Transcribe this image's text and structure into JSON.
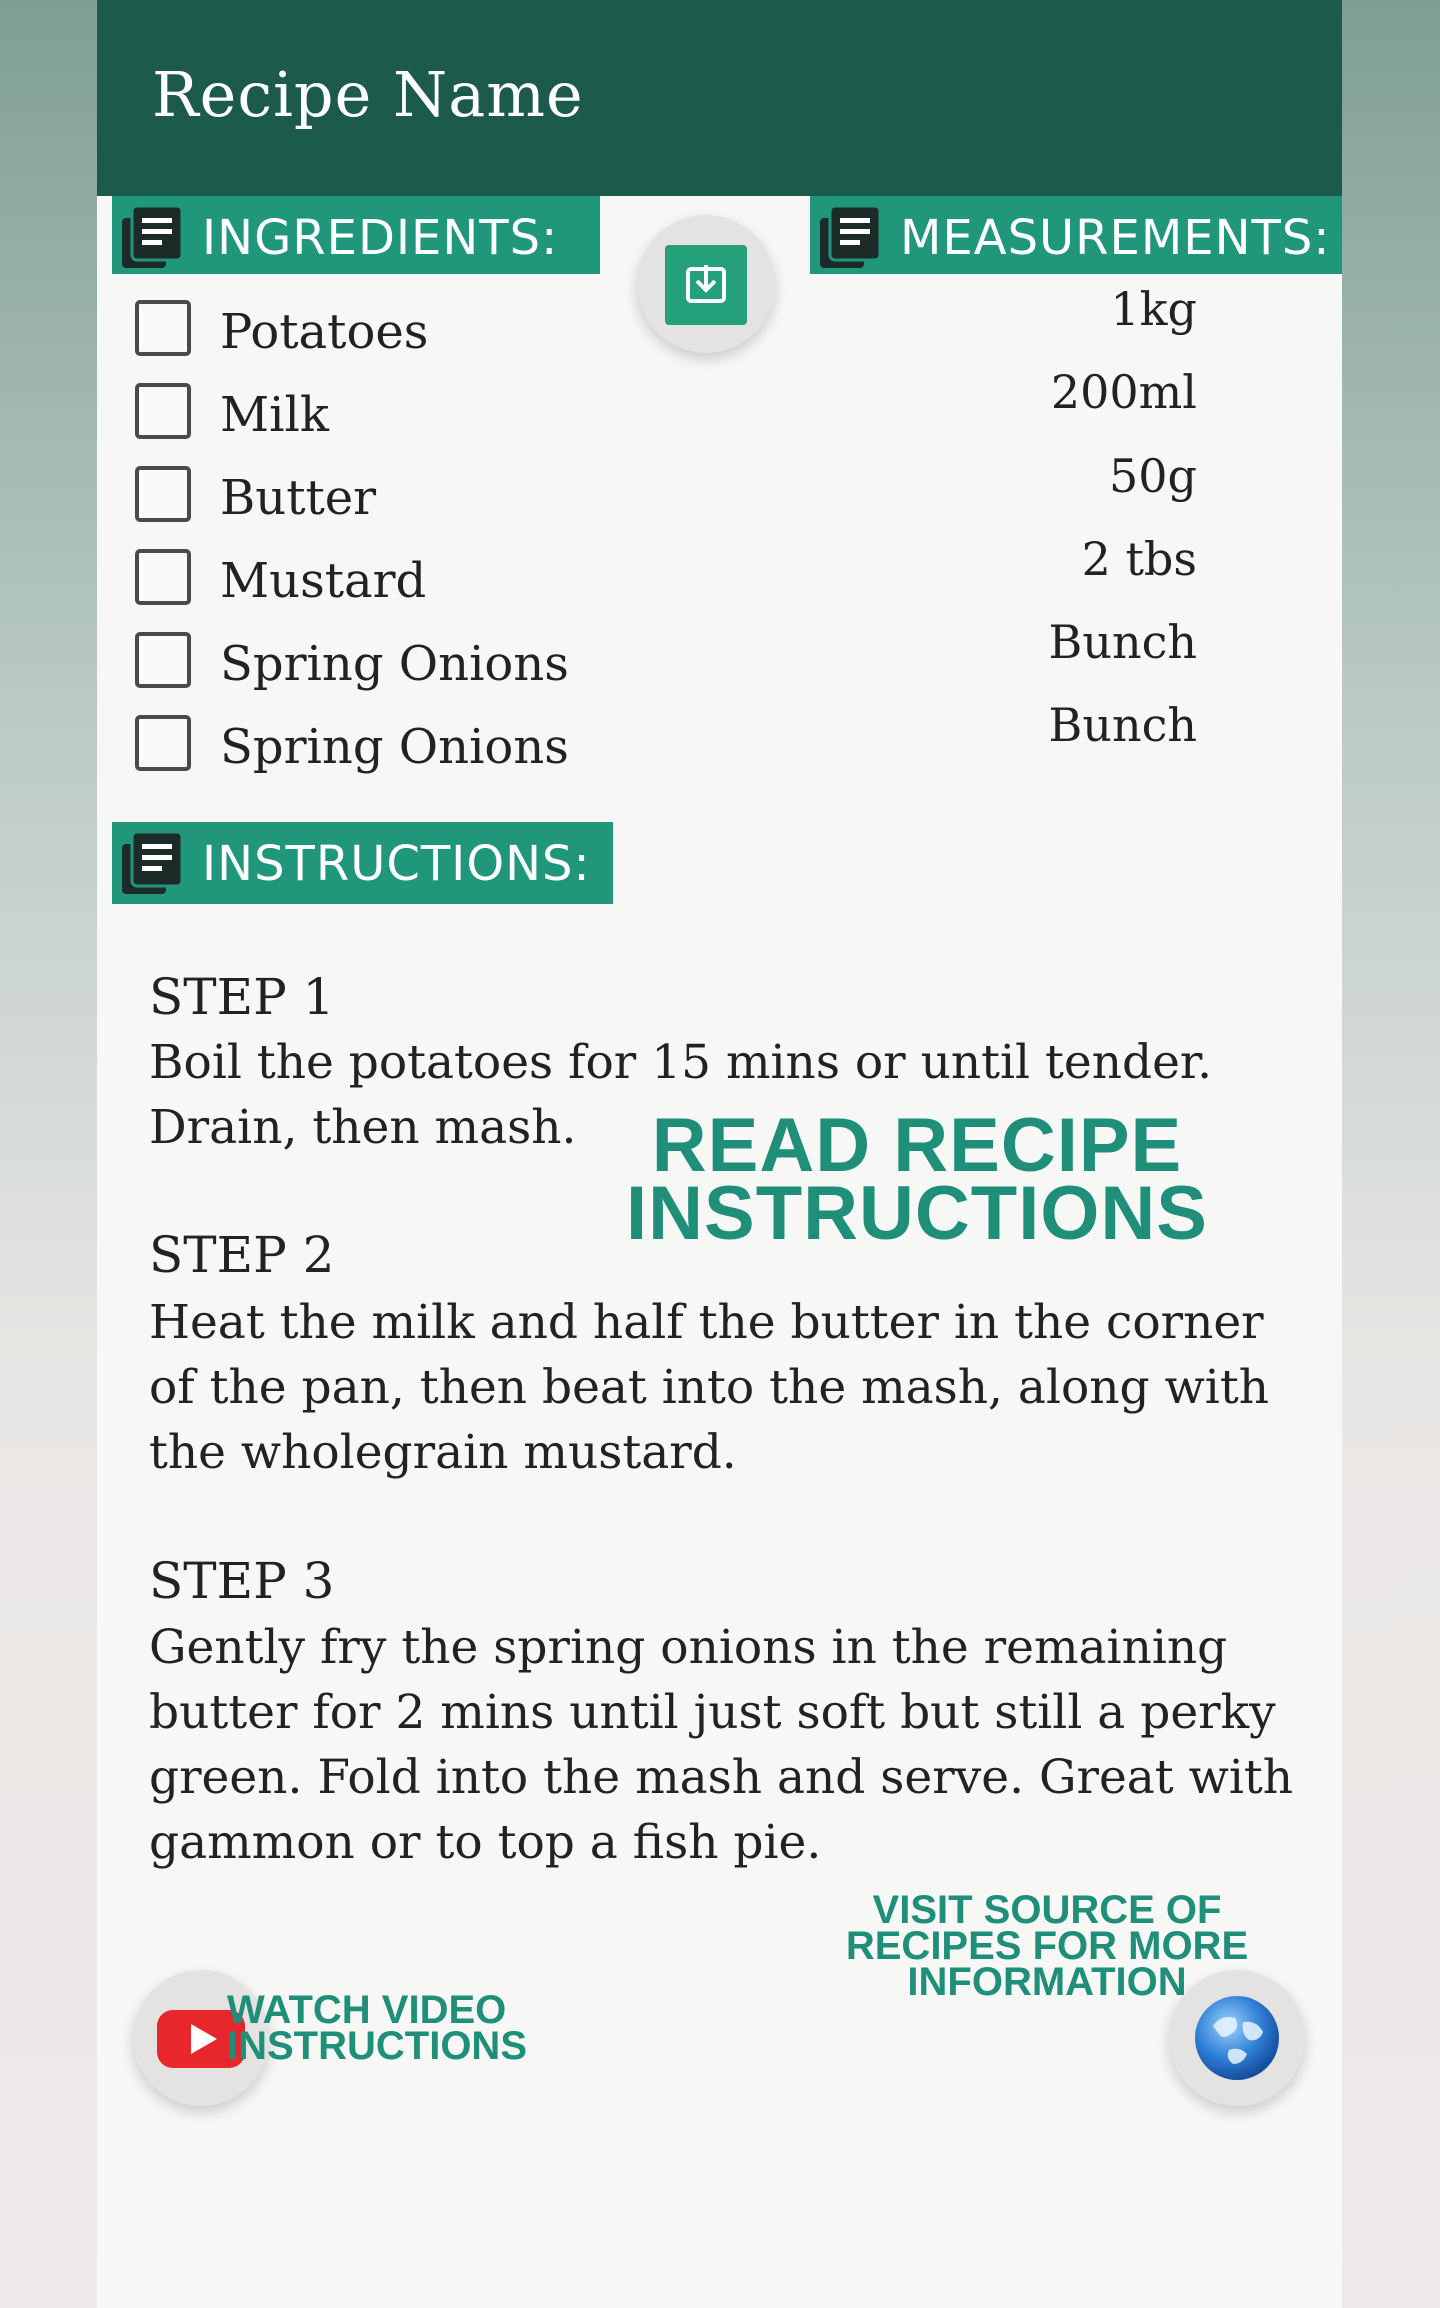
{
  "app": {
    "title": "Recipe Name"
  },
  "sections": {
    "ingredients": "INGREDIENTS:",
    "measurements": "MEASUREMENTS:",
    "instructions": "INSTRUCTIONS:"
  },
  "ingredients": [
    {
      "name": "Potatoes",
      "measure": "1kg"
    },
    {
      "name": "Milk",
      "measure": "200ml"
    },
    {
      "name": "Butter",
      "measure": "50g"
    },
    {
      "name": "Mustard",
      "measure": "2 tbs"
    },
    {
      "name": "Spring Onions",
      "measure": "Bunch"
    },
    {
      "name": "Spring Onions",
      "measure": "Bunch"
    }
  ],
  "steps": [
    {
      "title": "STEP 1",
      "text": "Boil the potatoes for 15 mins or until tender. Drain, then mash."
    },
    {
      "title": "STEP 2",
      "text": "Heat the milk and half the butter in the corner of the pan, then beat into the mash, along with the wholegrain mustard."
    },
    {
      "title": "STEP 3",
      "text": "Gently fry the spring onions in the remaining butter for 2 mins until just soft but still a perky green. Fold into the mash and serve. Great with gammon or to top a fish pie."
    }
  ],
  "overlays": {
    "read": "READ RECIPE INSTRUCTIONS",
    "visit": "VISIT SOURCE OF RECIPES FOR MORE INFORMATION",
    "watch": "WATCH VIDEO INSTRUCTIONS"
  },
  "icons": {
    "section": "document-list-icon",
    "save": "download-icon",
    "video": "youtube-icon",
    "web": "globe-icon"
  },
  "colors": {
    "app_bar": "#1c5a4b",
    "section_header": "#20977b",
    "overlay_text": "#1f8f7a"
  }
}
